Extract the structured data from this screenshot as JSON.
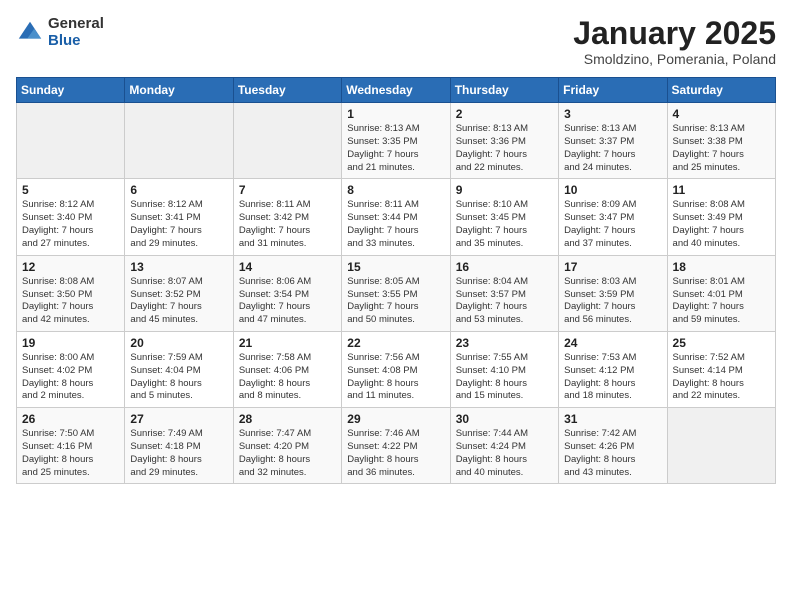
{
  "logo": {
    "general": "General",
    "blue": "Blue"
  },
  "title": "January 2025",
  "subtitle": "Smoldzino, Pomerania, Poland",
  "days_of_week": [
    "Sunday",
    "Monday",
    "Tuesday",
    "Wednesday",
    "Thursday",
    "Friday",
    "Saturday"
  ],
  "weeks": [
    [
      {
        "num": "",
        "info": ""
      },
      {
        "num": "",
        "info": ""
      },
      {
        "num": "",
        "info": ""
      },
      {
        "num": "1",
        "info": "Sunrise: 8:13 AM\nSunset: 3:35 PM\nDaylight: 7 hours\nand 21 minutes."
      },
      {
        "num": "2",
        "info": "Sunrise: 8:13 AM\nSunset: 3:36 PM\nDaylight: 7 hours\nand 22 minutes."
      },
      {
        "num": "3",
        "info": "Sunrise: 8:13 AM\nSunset: 3:37 PM\nDaylight: 7 hours\nand 24 minutes."
      },
      {
        "num": "4",
        "info": "Sunrise: 8:13 AM\nSunset: 3:38 PM\nDaylight: 7 hours\nand 25 minutes."
      }
    ],
    [
      {
        "num": "5",
        "info": "Sunrise: 8:12 AM\nSunset: 3:40 PM\nDaylight: 7 hours\nand 27 minutes."
      },
      {
        "num": "6",
        "info": "Sunrise: 8:12 AM\nSunset: 3:41 PM\nDaylight: 7 hours\nand 29 minutes."
      },
      {
        "num": "7",
        "info": "Sunrise: 8:11 AM\nSunset: 3:42 PM\nDaylight: 7 hours\nand 31 minutes."
      },
      {
        "num": "8",
        "info": "Sunrise: 8:11 AM\nSunset: 3:44 PM\nDaylight: 7 hours\nand 33 minutes."
      },
      {
        "num": "9",
        "info": "Sunrise: 8:10 AM\nSunset: 3:45 PM\nDaylight: 7 hours\nand 35 minutes."
      },
      {
        "num": "10",
        "info": "Sunrise: 8:09 AM\nSunset: 3:47 PM\nDaylight: 7 hours\nand 37 minutes."
      },
      {
        "num": "11",
        "info": "Sunrise: 8:08 AM\nSunset: 3:49 PM\nDaylight: 7 hours\nand 40 minutes."
      }
    ],
    [
      {
        "num": "12",
        "info": "Sunrise: 8:08 AM\nSunset: 3:50 PM\nDaylight: 7 hours\nand 42 minutes."
      },
      {
        "num": "13",
        "info": "Sunrise: 8:07 AM\nSunset: 3:52 PM\nDaylight: 7 hours\nand 45 minutes."
      },
      {
        "num": "14",
        "info": "Sunrise: 8:06 AM\nSunset: 3:54 PM\nDaylight: 7 hours\nand 47 minutes."
      },
      {
        "num": "15",
        "info": "Sunrise: 8:05 AM\nSunset: 3:55 PM\nDaylight: 7 hours\nand 50 minutes."
      },
      {
        "num": "16",
        "info": "Sunrise: 8:04 AM\nSunset: 3:57 PM\nDaylight: 7 hours\nand 53 minutes."
      },
      {
        "num": "17",
        "info": "Sunrise: 8:03 AM\nSunset: 3:59 PM\nDaylight: 7 hours\nand 56 minutes."
      },
      {
        "num": "18",
        "info": "Sunrise: 8:01 AM\nSunset: 4:01 PM\nDaylight: 7 hours\nand 59 minutes."
      }
    ],
    [
      {
        "num": "19",
        "info": "Sunrise: 8:00 AM\nSunset: 4:02 PM\nDaylight: 8 hours\nand 2 minutes."
      },
      {
        "num": "20",
        "info": "Sunrise: 7:59 AM\nSunset: 4:04 PM\nDaylight: 8 hours\nand 5 minutes."
      },
      {
        "num": "21",
        "info": "Sunrise: 7:58 AM\nSunset: 4:06 PM\nDaylight: 8 hours\nand 8 minutes."
      },
      {
        "num": "22",
        "info": "Sunrise: 7:56 AM\nSunset: 4:08 PM\nDaylight: 8 hours\nand 11 minutes."
      },
      {
        "num": "23",
        "info": "Sunrise: 7:55 AM\nSunset: 4:10 PM\nDaylight: 8 hours\nand 15 minutes."
      },
      {
        "num": "24",
        "info": "Sunrise: 7:53 AM\nSunset: 4:12 PM\nDaylight: 8 hours\nand 18 minutes."
      },
      {
        "num": "25",
        "info": "Sunrise: 7:52 AM\nSunset: 4:14 PM\nDaylight: 8 hours\nand 22 minutes."
      }
    ],
    [
      {
        "num": "26",
        "info": "Sunrise: 7:50 AM\nSunset: 4:16 PM\nDaylight: 8 hours\nand 25 minutes."
      },
      {
        "num": "27",
        "info": "Sunrise: 7:49 AM\nSunset: 4:18 PM\nDaylight: 8 hours\nand 29 minutes."
      },
      {
        "num": "28",
        "info": "Sunrise: 7:47 AM\nSunset: 4:20 PM\nDaylight: 8 hours\nand 32 minutes."
      },
      {
        "num": "29",
        "info": "Sunrise: 7:46 AM\nSunset: 4:22 PM\nDaylight: 8 hours\nand 36 minutes."
      },
      {
        "num": "30",
        "info": "Sunrise: 7:44 AM\nSunset: 4:24 PM\nDaylight: 8 hours\nand 40 minutes."
      },
      {
        "num": "31",
        "info": "Sunrise: 7:42 AM\nSunset: 4:26 PM\nDaylight: 8 hours\nand 43 minutes."
      },
      {
        "num": "",
        "info": ""
      }
    ]
  ]
}
